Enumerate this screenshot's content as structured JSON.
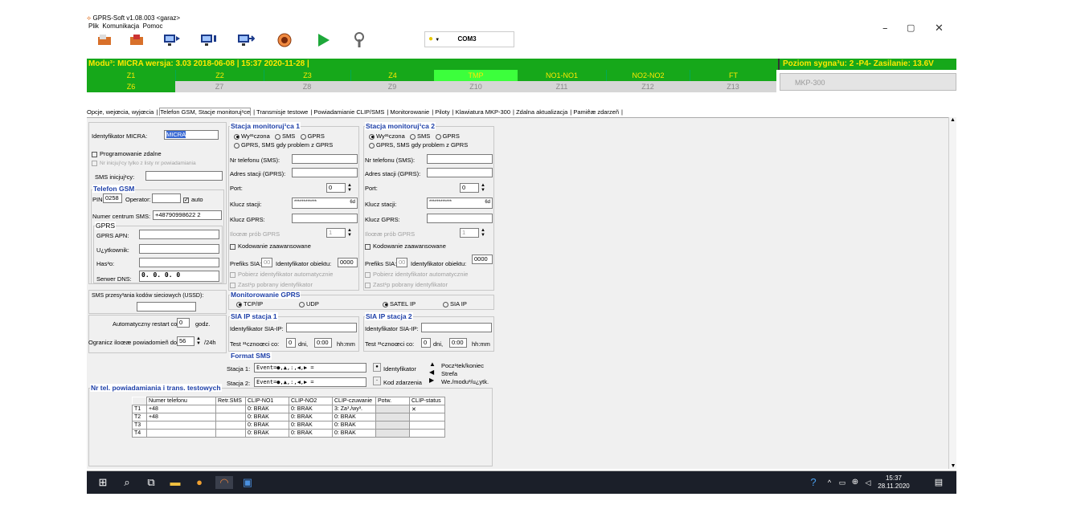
{
  "window": {
    "title": "GPRS-Soft v1.08.003  <garaz>",
    "menu": [
      "Plik",
      "Komunikacja",
      "Pomoc"
    ],
    "controls": {
      "minimize": "–",
      "maximize": "▢",
      "close": "✕"
    }
  },
  "toolbar": {
    "port": "COM3",
    "icons": [
      "open-file-icon",
      "save-file-icon",
      "read-monitor-icon",
      "write-monitor-icon",
      "transfer-monitor-icon",
      "stop-icon",
      "play-icon",
      "tools-icon",
      "status-light-icon"
    ]
  },
  "status": {
    "left": "Modu³: MICRA wersja: 3.03 2018-06-08   | 15:37  2020-11-28 |",
    "right": "Poziom sygna³u: 2 -P4-  Zasilanie: 13.6V"
  },
  "zones": {
    "row1": [
      "Z1",
      "Z2",
      "Z3",
      "Z4",
      "TMP",
      "NO1-NO1",
      "NO2-NO2",
      "FT"
    ],
    "row2": [
      "Z6",
      "Z7",
      "Z8",
      "Z9",
      "Z10",
      "Z11",
      "Z12",
      "Z13"
    ],
    "extra": "MKP-300"
  },
  "tabs": [
    "Opcje, wejœcia, wyjœcia",
    "Telefon GSM, Stacje monitoruj¹ce",
    "Transmisje testowe",
    "Powiadamianie CLIP/SMS",
    "Monitorowanie",
    "Piloty",
    "Klawiatura MKP-300",
    "Zdalna aktualizacja",
    "Pamiêæ zdarzeñ"
  ],
  "left": {
    "id_label": "Identyfikator MICRA:",
    "id_value": "MICRA",
    "remote_prog": "Programowanie zdalne",
    "initiating": "Nr inicjuj¹cy tylko z listy nr powiadamiania",
    "sms_init": "SMS inicjuj¹cy:"
  },
  "gsm": {
    "title": "Telefon GSM",
    "pin_label": "PIN:",
    "pin": "0258",
    "operator_label": "Operator:",
    "auto": "auto",
    "sms_center_label": "Numer centrum SMS:",
    "sms_center": "+48790998622 2",
    "gprs_title": "GPRS",
    "apn": "GPRS APN:",
    "user": "U¿ytkownik:",
    "pass": "Has³o:",
    "dns": "Serwer DNS:",
    "dns_value": "0.  0.  0.  0"
  },
  "misc": {
    "ussd": "SMS przesy³ania kodów sieciowych (USSD):",
    "restart": "Automatyczny restart co:",
    "restart_val": "0",
    "restart_unit": "godz.",
    "limit": "Ogranicz iloœæ powiadomieñ do:",
    "limit_val": "56",
    "limit_unit": "/24h"
  },
  "st1": {
    "title": "Stacja monitoruj¹ca 1",
    "off": "Wy³¹czona",
    "sms": "SMS",
    "gprs": "GPRS",
    "gprs_sms": "GPRS, SMS gdy problem z GPRS",
    "phone": "Nr telefonu (SMS):",
    "addr": "Adres stacji (GPRS):",
    "port": "Port:",
    "port_val": "0",
    "key": "Klucz stacji:",
    "key_val": "************",
    "key_btn": "6d",
    "gkey": "Klucz GPRS:",
    "tries": "Iloœæ prób GPRS",
    "tries_val": "1",
    "adv": "Kodowanie zaawansowane",
    "sia_prefix": "Prefiks SIA:",
    "sia_prefix_val": "00",
    "obj": "Identyfikator obiektu:",
    "obj_val": "0000",
    "auto_id": "Pobierz identyfikator automatycznie",
    "replace_id": "Zast¹p pobrany identyfikator"
  },
  "st2": {
    "title": "Stacja monitoruj¹ca 2",
    "off": "Wy³¹czona",
    "sms": "SMS",
    "gprs": "GPRS",
    "gprs_sms": "GPRS, SMS gdy problem z GPRS",
    "phone": "Nr telefonu (SMS):",
    "addr": "Adres stacji (GPRS):",
    "port": "Port:",
    "port_val": "0",
    "key": "Klucz stacji:",
    "key_val": "************",
    "key_btn": "6d",
    "gkey": "Klucz GPRS:",
    "tries": "Iloœæ prób GPRS",
    "tries_val": "1",
    "adv": "Kodowanie zaawansowane",
    "sia_prefix": "Prefiks SIA:",
    "sia_prefix_val": "00",
    "obj": "Identyfikator obiektu:",
    "obj_val": "0000",
    "auto_id": "Pobierz identyfikator automatycznie",
    "replace_id": "Zast¹p pobrany identyfikator"
  },
  "mon": {
    "title": "Monitorowanie GPRS",
    "tcp": "TCP/IP",
    "udp": "UDP",
    "satel": "SATEL IP",
    "sia": "SIA IP"
  },
  "sia1": {
    "title": "SIA IP stacja 1",
    "id": "Identyfikator SIA-IP:",
    "test": "Test ³¹cznoœci co:",
    "days": "0",
    "dni": "dni,",
    "time": "0:00",
    "hm": "hh:mm"
  },
  "sia2": {
    "title": "SIA IP stacja 2",
    "id": "Identyfikator SIA-IP:",
    "test": "Test ³¹cznoœci co:",
    "days": "0",
    "dni": "dni,",
    "time": "0:00",
    "hm": "hh:mm"
  },
  "fmt": {
    "title": "Format SMS",
    "s1": "Stacja 1:",
    "s1v": "Event=●,▲,:,◀,▶ =",
    "s2": "Stacja 2:",
    "s2v": "Event=●,▲,:,◀,▶ =",
    "ident": "Identyfikator",
    "code": "Kod zdarzenia",
    "start": "Pocz¹tek/koniec",
    "zone": "Strefa",
    "mod": "We./modu³/u¿ytk."
  },
  "phones": {
    "title": "Nr tel. powiadamiania i trans. testowych",
    "headers": [
      "",
      "Numer telefonu",
      "Retr.SMS",
      "CLIP-NO1",
      "CLIP-NO2",
      "CLIP-czuwanie",
      "Potw.",
      "CLIP-status"
    ],
    "rows": [
      [
        "T1",
        "+48",
        "",
        "0: BRAK",
        "0: BRAK",
        "3: Za³./wy³.",
        "",
        "✕"
      ],
      [
        "T2",
        "+48",
        "",
        "0: BRAK",
        "0: BRAK",
        "0: BRAK",
        "",
        ""
      ],
      [
        "T3",
        "",
        "",
        "0: BRAK",
        "0: BRAK",
        "0: BRAK",
        "",
        ""
      ],
      [
        "T4",
        "",
        "",
        "0: BRAK",
        "0: BRAK",
        "0: BRAK",
        "",
        ""
      ]
    ]
  },
  "taskbar": {
    "time": "15:37",
    "date": "28.11.2020"
  }
}
